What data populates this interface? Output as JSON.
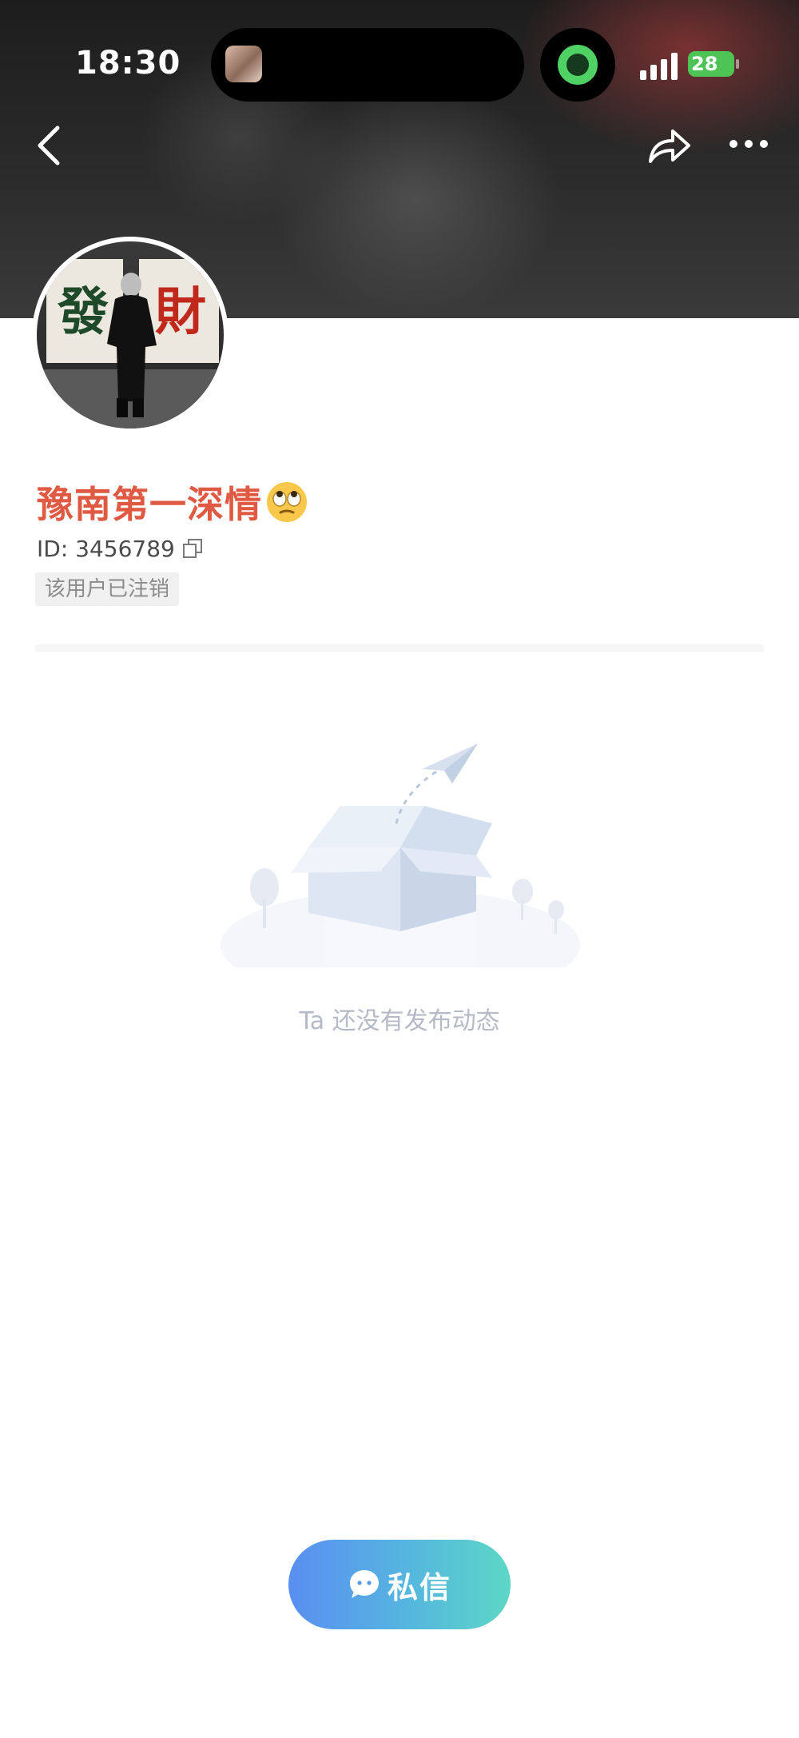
{
  "status_bar": {
    "time": "18:30",
    "battery": "28"
  },
  "profile": {
    "nickname": "豫南第一深情",
    "id_text": "ID: 3456789",
    "status_badge": "该用户已注销",
    "avatar_left_char": "發",
    "avatar_right_char": "財"
  },
  "feed": {
    "empty_text": "Ta 还没有发布动态"
  },
  "actions": {
    "dm_label": "私信"
  },
  "icons": {
    "back": "chevron-left-icon",
    "share": "share-arrow-icon",
    "more": "more-dots-icon",
    "copy": "copy-icon",
    "emoji": "rolling-eyes-emoji",
    "dm": "chat-bubble-icon"
  },
  "colors": {
    "nickname": "#e05a43",
    "dm_gradient_start": "#5a8ef2",
    "dm_gradient_end": "#5dd7c6",
    "battery": "#4fc456"
  }
}
